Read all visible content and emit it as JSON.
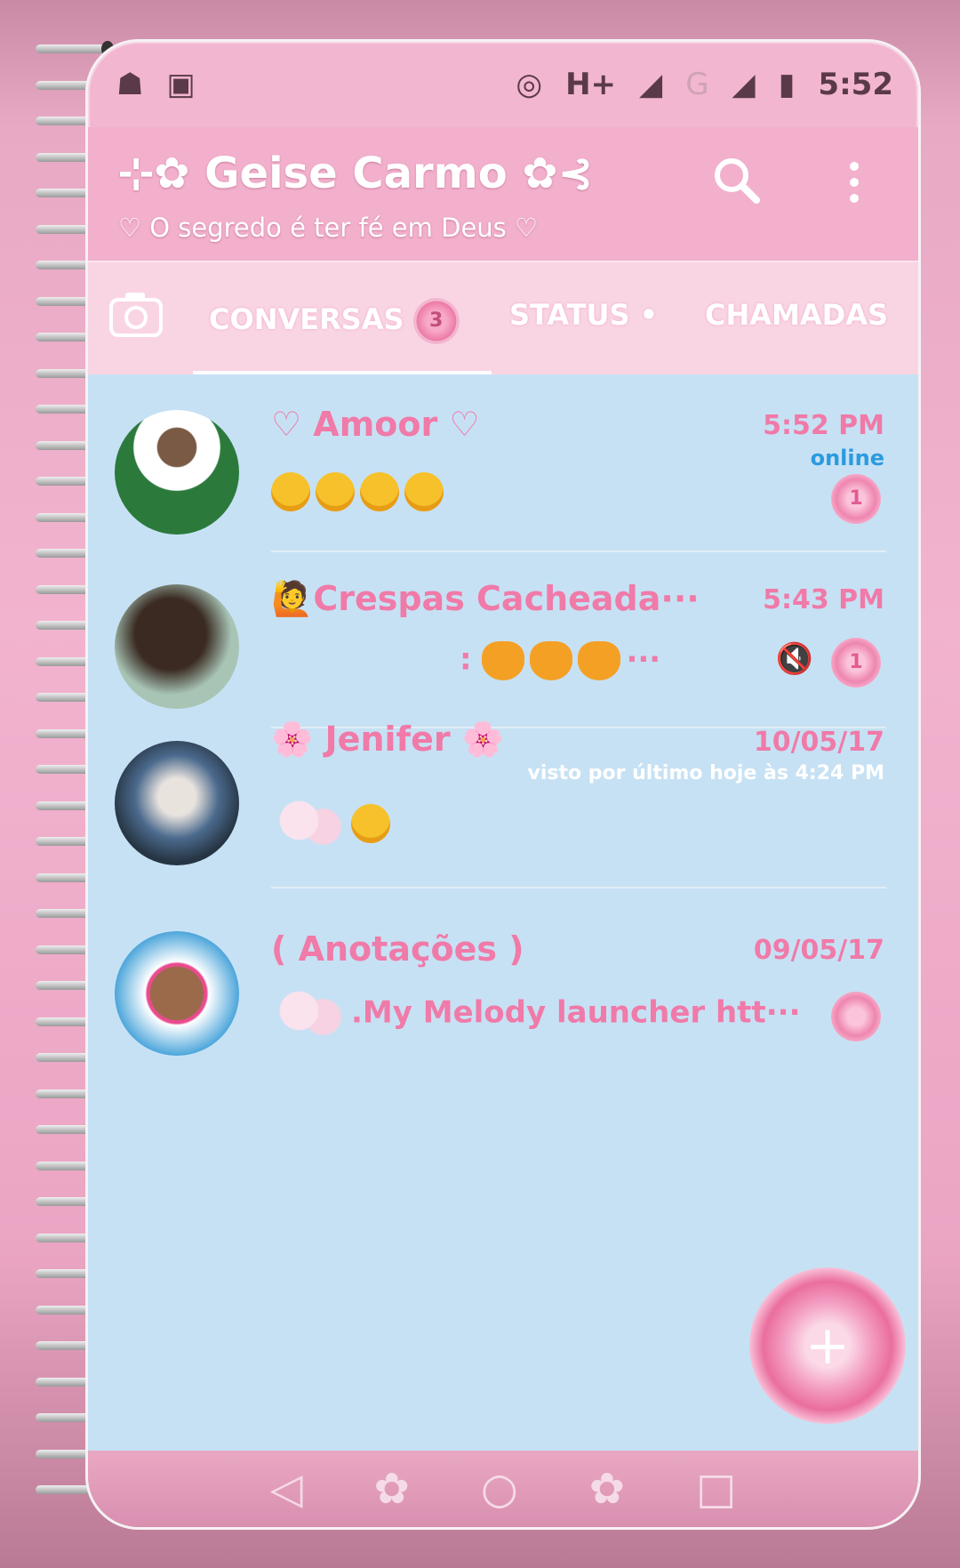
{
  "status_bar": {
    "network": "H+",
    "network2": "G",
    "time": "5:52"
  },
  "header": {
    "title": "⊹✿ Geise Carmo ✿⊰",
    "subtitle": "♡ O segredo é ter fé em Deus ♡"
  },
  "tabs": [
    {
      "label": "CONVERSAS",
      "badge": "3"
    },
    {
      "label": "STATUS"
    },
    {
      "label": "CHAMADAS"
    }
  ],
  "chats": [
    {
      "name": "♡ Amoor ♡",
      "time": "5:52 PM",
      "status": "online",
      "unread": "1"
    },
    {
      "name": "Crespas Cacheada···",
      "time": "5:43 PM",
      "preview_prefix": ":",
      "preview_suffix": "···",
      "unread": "1"
    },
    {
      "name": "Jenifer",
      "time": "10/05/17",
      "status": "visto por último hoje às 4:24 PM"
    },
    {
      "name": "( Anotações )",
      "time": "09/05/17",
      "preview": ".My Melody launcher htt···"
    }
  ],
  "colors": {
    "accent_pink": "#f07aa8",
    "list_bg": "#c7e1f4",
    "tab_bg": "#f9d5e4",
    "appbar_bg": "#f2b0cd",
    "online_blue": "#2a9be0"
  },
  "icons": [
    "search-icon",
    "more-vert-icon",
    "camera-icon",
    "back-icon",
    "home-icon",
    "recents-icon",
    "new-chat-icon"
  ]
}
